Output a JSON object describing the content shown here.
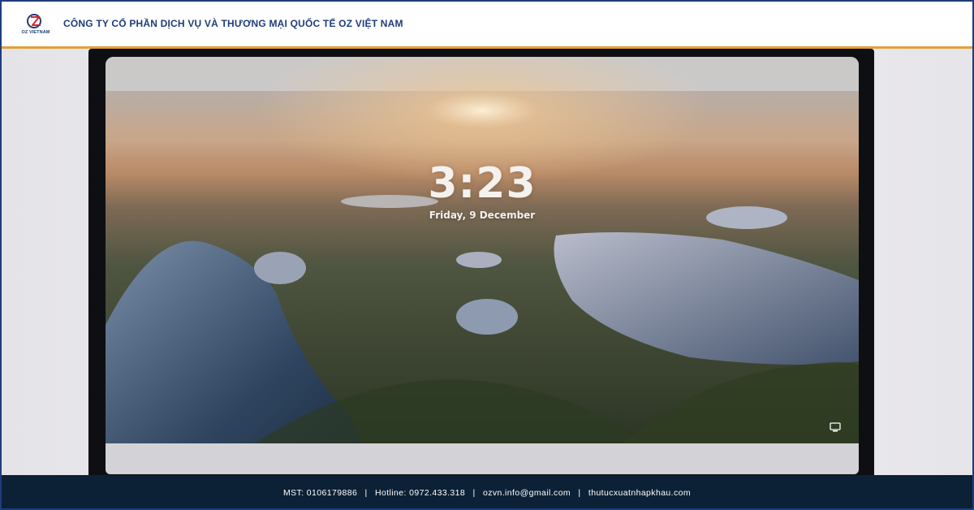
{
  "header": {
    "logo_text": "OZ VIETNAM",
    "company_name": "CÔNG TY CỔ PHẦN DỊCH VỤ VÀ THƯƠNG MẠI QUỐC TẾ OZ VIỆT NAM"
  },
  "lock_screen": {
    "time": "3:23",
    "date": "Friday, 9 December",
    "status_icon": "network-icon"
  },
  "footer": {
    "mst": "MST: 0106179886",
    "hotline": "Hotline: 0972.433.318",
    "email": "ozvn.info@gmail.com",
    "website": "thutucxuatnhapkhau.com",
    "separator": "|"
  },
  "colors": {
    "brand_navy": "#1f3d7a",
    "accent_orange": "#e2a13a",
    "footer_bg": "#0c2136"
  }
}
